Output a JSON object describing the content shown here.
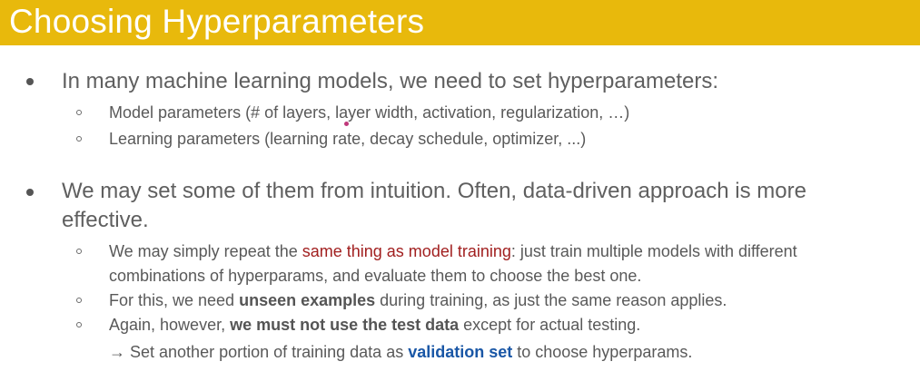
{
  "title": "Choosing Hyperparameters",
  "bullets": [
    {
      "text": "In many machine learning models, we need to set hyperparameters:",
      "sub": [
        "Model parameters (# of layers, layer width, activation, regularization, …)",
        "Learning parameters (learning rate, decay schedule, optimizer, ...)"
      ]
    },
    {
      "text_line1": "We may set some of them from intuition. Often, data-driven approach is more",
      "text_line2": "effective.",
      "sub": {
        "s1_pre": "We may simply repeat the ",
        "s1_red": "same thing as model training",
        "s1_post": ": just train multiple models with different",
        "s1_line2": "combinations of hyperparams, and evaluate them to choose the best one.",
        "s2_pre": "For this, we need ",
        "s2_bold": "unseen examples",
        "s2_post": " during training, as just the same reason applies.",
        "s3_pre": "Again, however, ",
        "s3_bold": "we must not use the test data",
        "s3_post": " except for actual testing.",
        "s3_line2_pre": "→ Set another portion of training data as ",
        "s3_line2_blue": "validation set",
        "s3_line2_post": " to choose hyperparams."
      }
    }
  ],
  "colors": {
    "title_bar": "#e8b90c",
    "body_text": "#5f5f5f",
    "emphasis_red": "#a11f1f",
    "emphasis_blue": "#1a57a6"
  }
}
